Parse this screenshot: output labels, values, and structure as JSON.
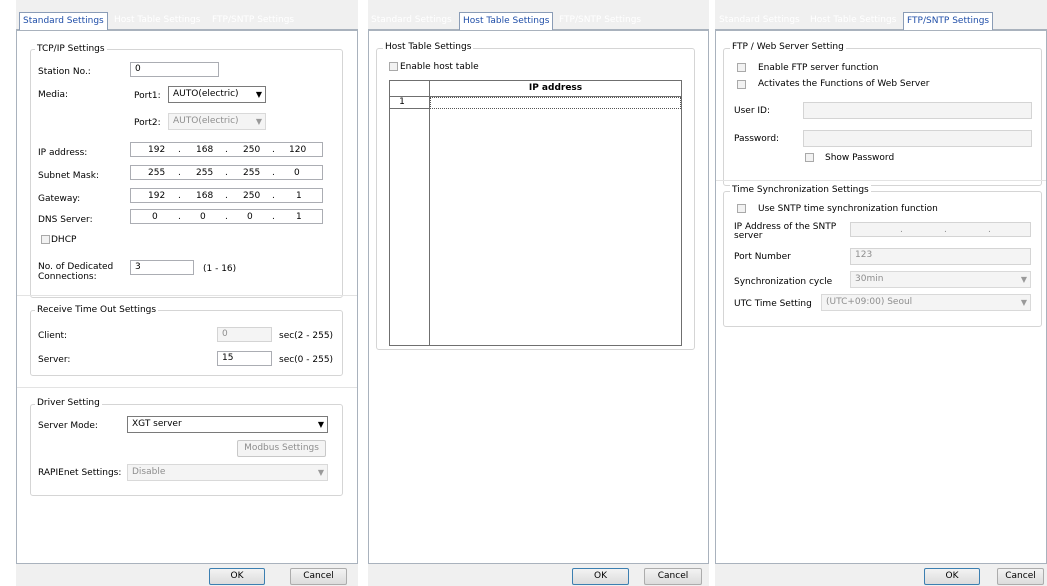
{
  "tabs": [
    "Standard Settings",
    "Host Table Settings",
    "FTP/SNTP Settings"
  ],
  "buttons": {
    "ok": "OK",
    "cancel": "Cancel"
  },
  "standard": {
    "tcpip_title": "TCP/IP Settings",
    "station_label": "Station No.:",
    "station_value": "0",
    "media_label": "Media:",
    "port1_label": "Port1:",
    "port1_value": "AUTO(electric)",
    "port2_label": "Port2:",
    "port2_value": "AUTO(electric)",
    "ip_label": "IP address:",
    "ip": [
      "192",
      "168",
      "250",
      "120"
    ],
    "mask_label": "Subnet Mask:",
    "mask": [
      "255",
      "255",
      "255",
      "0"
    ],
    "gateway_label": "Gateway:",
    "gateway": [
      "192",
      "168",
      "250",
      "1"
    ],
    "dns_label": "DNS Server:",
    "dns": [
      "0",
      "0",
      "0",
      "1"
    ],
    "ip_dot": ".",
    "dhcp_label": "DHCP",
    "dedicated_label_1": "No. of Dedicated",
    "dedicated_label_2": "Connections:",
    "dedicated_value": "3",
    "dedicated_range": "(1 - 16)",
    "timeout_title": "Receive Time Out Settings",
    "client_label": "Client:",
    "client_value": "0",
    "client_range": "sec(2 - 255)",
    "server_label": "Server:",
    "server_value": "15",
    "server_range": "sec(0 - 255)",
    "driver_title": "Driver Setting",
    "server_mode_label": "Server Mode:",
    "server_mode_value": "XGT server",
    "modbus_button": "Modbus Settings",
    "rapienet_label": "RAPIEnet Settings:",
    "rapienet_value": "Disable"
  },
  "host": {
    "group_title": "Host Table Settings",
    "enable_label": "Enable host table",
    "column_header": "IP address",
    "row_number": "1"
  },
  "ftp": {
    "ftp_title": "FTP / Web Server Setting",
    "enable_ftp": "Enable FTP server function",
    "activate_web": "Activates the Functions of Web Server",
    "user_label": "User ID:",
    "password_label": "Password:",
    "show_password": "Show Password",
    "time_title": "Time Synchronization Settings",
    "use_sntp": "Use SNTP time synchronization function",
    "sntp_ip_label_1": "IP Address of the SNTP",
    "sntp_ip_label_2": "server",
    "port_label": "Port Number",
    "port_value": "123",
    "cycle_label": "Synchronization cycle",
    "cycle_value": "30min",
    "utc_label": "UTC Time Setting",
    "utc_value": "(UTC+09:00) Seoul"
  }
}
